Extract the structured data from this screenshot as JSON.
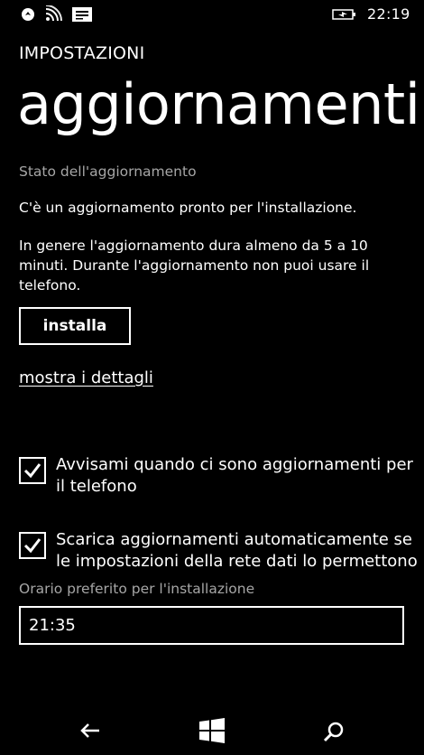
{
  "status_bar": {
    "time": "22:19",
    "icons": [
      "nfc-icon",
      "wifi-icon",
      "notification-icon",
      "battery-charging-icon"
    ]
  },
  "header": {
    "app_title": "IMPOSTAZIONI",
    "page_title": "aggiornamenti"
  },
  "update": {
    "section_label": "Stato dell'aggiornamento",
    "status": "C'è un aggiornamento pronto per l'installazione.",
    "info": "In genere l'aggiornamento dura almeno da 5 a 10 minuti. Durante l'aggiornamento non puoi usare il telefono.",
    "install_label": "installa",
    "details_link": "mostra i dettagli"
  },
  "options": {
    "notify": {
      "checked": true,
      "line1": "Avvisami quando ci sono aggiornamenti per",
      "line2": "il telefono"
    },
    "auto_download": {
      "checked": true,
      "line1": "Scarica aggiornamenti automaticamente se",
      "line2": "le impostazioni della rete dati lo permettono"
    }
  },
  "install_time": {
    "label": "Orario preferito per l'installazione",
    "value": "21:35"
  },
  "nav": {
    "icons": [
      "back-arrow-icon",
      "windows-start-icon",
      "search-icon"
    ]
  },
  "colors": {
    "background": "#000000",
    "text": "#ffffff",
    "secondary_text": "#a6a6a6"
  }
}
